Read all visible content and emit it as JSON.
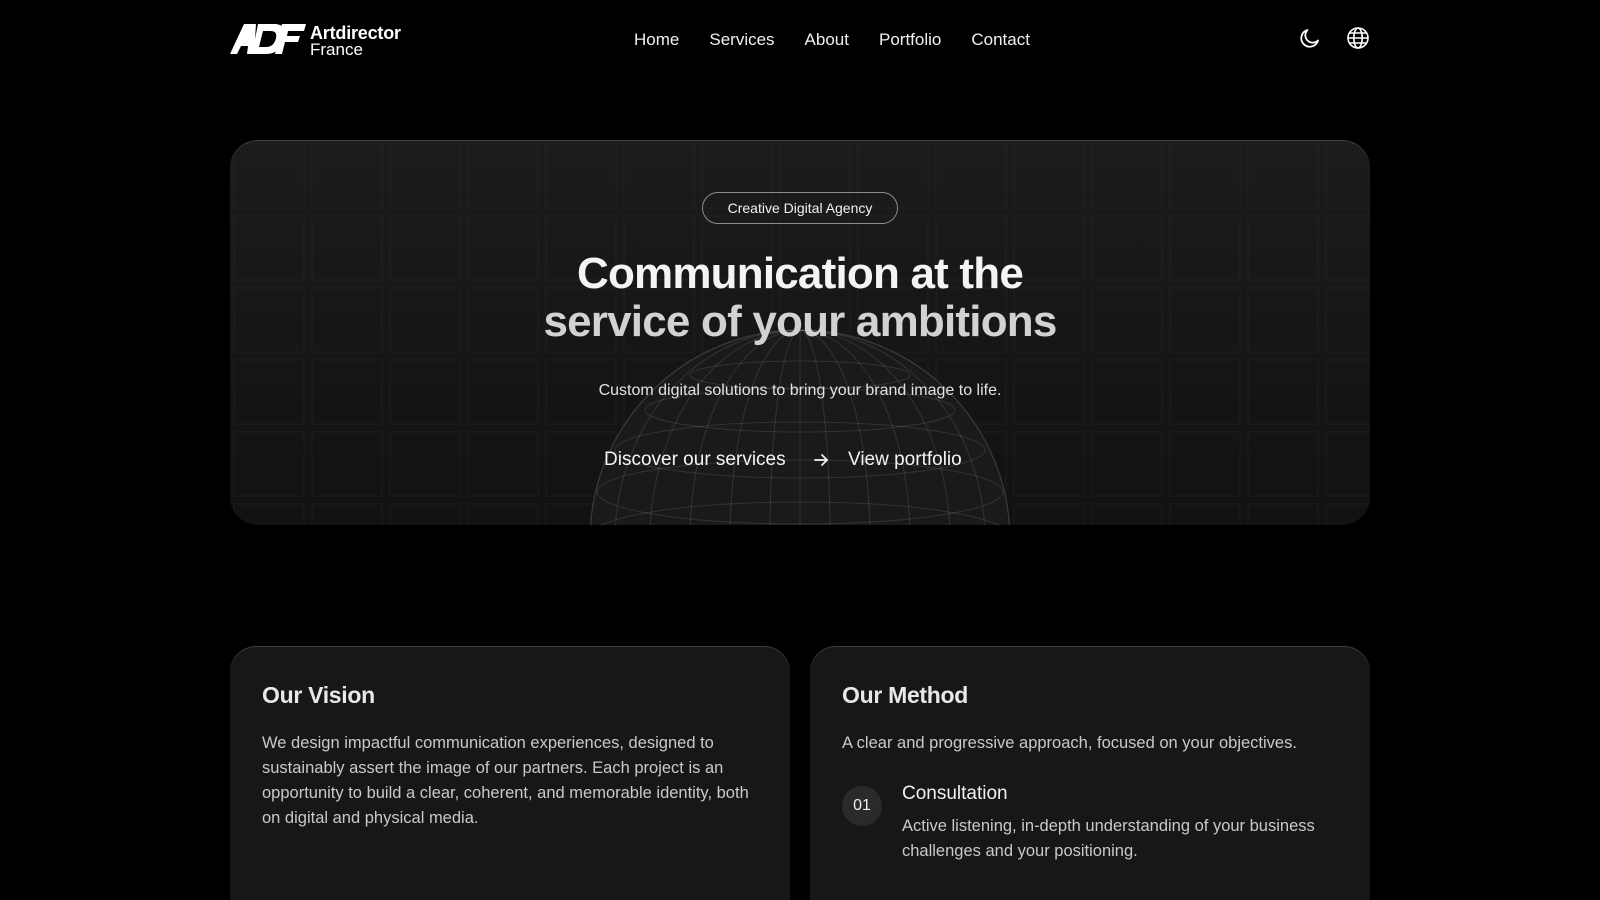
{
  "header": {
    "logo_name": "Artdirector",
    "logo_sub": "France",
    "nav": [
      {
        "label": "Home"
      },
      {
        "label": "Services"
      },
      {
        "label": "About"
      },
      {
        "label": "Portfolio"
      },
      {
        "label": "Contact"
      }
    ],
    "icons": [
      "moon-icon",
      "globe-icon"
    ]
  },
  "hero": {
    "badge": "Creative Digital Agency",
    "title_line1": "Communication at the",
    "title_line2": "service of your ambitions",
    "subtitle": "Custom digital solutions to bring your brand image to life.",
    "primary_cta": "Discover our services",
    "secondary_cta": "View portfolio",
    "arrow_icon": "arrow-right-icon"
  },
  "vision": {
    "title": "Our Vision",
    "text": "We design impactful communication experiences, designed to sustainably assert the image of our partners. Each project is an opportunity to build a clear, coherent, and memorable identity, both on digital and physical media."
  },
  "method": {
    "title": "Our Method",
    "intro": "A clear and progressive approach, focused on your objectives.",
    "steps": [
      {
        "number": "01",
        "title": "Consultation",
        "description": "Active listening, in-depth understanding of your business challenges and your positioning."
      }
    ]
  },
  "colors": {
    "background": "#000000",
    "card": "#171718",
    "text": "#f0f0f0",
    "muted_text": "#c9c9c9"
  }
}
